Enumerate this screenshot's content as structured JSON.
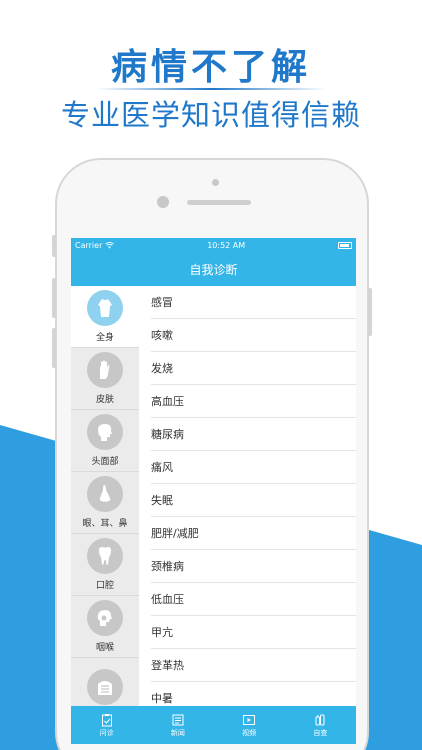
{
  "promo": {
    "title": "病情不了解",
    "subtitle": "专业医学知识值得信赖"
  },
  "status_bar": {
    "carrier": "Carrier",
    "time": "10:52 AM"
  },
  "nav": {
    "title": "自我诊断"
  },
  "sidebar": {
    "items": [
      {
        "label": "全身",
        "icon": "full-body-icon",
        "active": true
      },
      {
        "label": "皮肤",
        "icon": "hand-icon",
        "active": false
      },
      {
        "label": "头面部",
        "icon": "head-icon",
        "active": false
      },
      {
        "label": "眼、耳、鼻",
        "icon": "nose-icon",
        "active": false
      },
      {
        "label": "口腔",
        "icon": "tooth-icon",
        "active": false
      },
      {
        "label": "咽喉",
        "icon": "throat-icon",
        "active": false
      },
      {
        "label": "",
        "icon": "chest-icon",
        "active": false
      }
    ]
  },
  "diseases": [
    "感冒",
    "咳嗽",
    "发烧",
    "高血压",
    "糖尿病",
    "痛风",
    "失眠",
    "肥胖/减肥",
    "颈椎病",
    "低血压",
    "甲亢",
    "登革热",
    "中暑"
  ],
  "tabs": [
    {
      "label": "问诊",
      "icon": "clipboard-icon"
    },
    {
      "label": "新闻",
      "icon": "news-icon"
    },
    {
      "label": "视频",
      "icon": "video-icon"
    },
    {
      "label": "自查",
      "icon": "self-check-icon"
    }
  ],
  "colors": {
    "accent": "#33b5e8",
    "promo_text": "#1f78c9",
    "background_diagonal": "#2e9ee0"
  }
}
